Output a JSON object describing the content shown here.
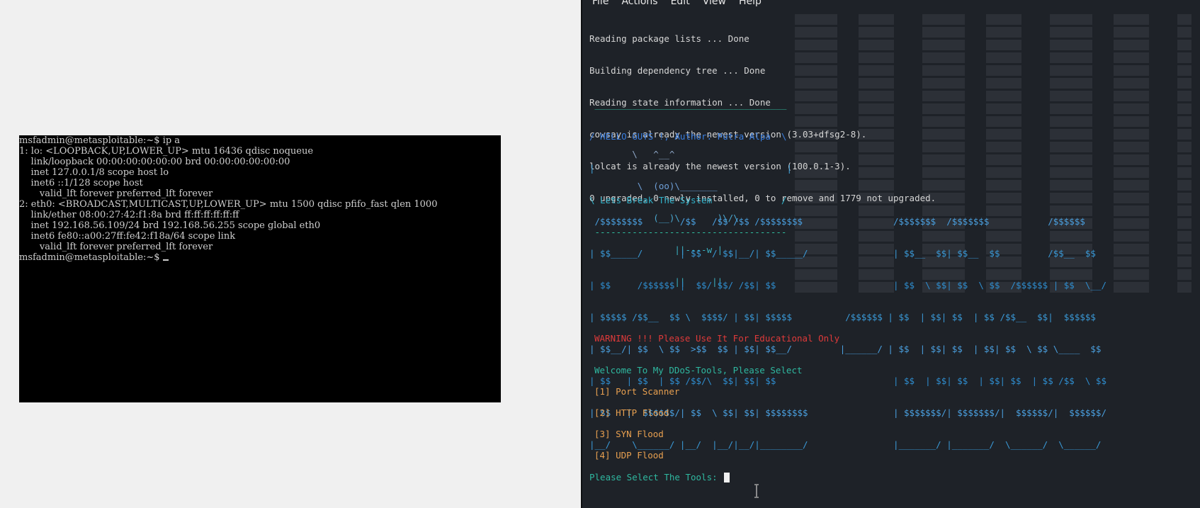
{
  "vm_console": {
    "lines": [
      "msfadmin@metasploitable:~$ ip a",
      "1: lo: <LOOPBACK,UP,LOWER_UP> mtu 16436 qdisc noqueue",
      "    link/loopback 00:00:00:00:00:00 brd 00:00:00:00:00:00",
      "    inet 127.0.0.1/8 scope host lo",
      "    inet6 ::1/128 scope host",
      "       valid_lft forever preferred_lft forever",
      "2: eth0: <BROADCAST,MULTICAST,UP,LOWER_UP> mtu 1500 qdisc pfifo_fast qlen 1000",
      "    link/ether 08:00:27:42:f1:8a brd ff:ff:ff:ff:ff:ff",
      "    inet 192.168.56.109/24 brd 192.168.56.255 scope global eth0",
      "    inet6 fe80::a00:27ff:fe42:f18a/64 scope link",
      "       valid_lft forever preferred_lft forever",
      "msfadmin@metasploitable:~$ "
    ]
  },
  "terminal": {
    "menu": [
      "File",
      "Actions",
      "Edit",
      "View",
      "Help"
    ],
    "apt_output": [
      "Reading package lists ... Done",
      "Building dependency tree ... Done",
      "Reading state information ... Done",
      "cowsay is already the newest version (3.03+dfsg2-8).",
      "lolcat is already the newest version (100.0.1-3).",
      "0 upgraded, 0 newly installed, 0 to remove and 1779 not upgraded."
    ],
    "speech_box": [
      " ____________________________________",
      "/ HELLO GUYS !, Author: Putra Alpa  \\",
      "|                                    |",
      "\\ Lets Break The System             /",
      " ------------------------------------"
    ],
    "cow": [
      "        \\   ^__^",
      "         \\  (oo)\\_______",
      "            (__)\\       )\\/\\",
      "                ||----w |",
      "                ||     ||"
    ],
    "banner": [
      " /$$$$$$$$       /$$   /$$ /$$ /$$$$$$$$                 /$$$$$$$  /$$$$$$$           /$$$$$$",
      "| $$_____/       | $$  / $$|__/| $$_____/                | $$__  $$| $$__  $$         /$$__  $$",
      "| $$     /$$$$$$ |  $$/ $$/ /$$| $$                      | $$  \\ $$| $$  \\ $$  /$$$$$$ | $$  \\__/",
      "| $$$$$ /$$__  $$ \\  $$$$/ | $$| $$$$$          /$$$$$$ | $$  | $$| $$  | $$ /$$__  $$|  $$$$$$",
      "| $$__/| $$  \\ $$  >$$  $$ | $$| $$__/         |______/ | $$  | $$| $$  | $$| $$  \\ $$ \\____  $$",
      "| $$   | $$  | $$ /$$/\\  $$| $$| $$                      | $$  | $$| $$  | $$| $$  | $$ /$$  \\ $$",
      "| $$   |  $$$$$$/| $$  \\ $$| $$| $$$$$$$$                | $$$$$$$/| $$$$$$$/|  $$$$$$/|  $$$$$$/",
      "|__/    \\______/ |__/  |__/|__/|________/                |_______/ |_______/  \\______/  \\______/"
    ],
    "warning": "WARNING !!! Please Use It For Educational Only",
    "welcome": "Welcome To My DDoS-Tools, Please Select",
    "options": [
      "[1] Port Scanner",
      "[2] HTTP Flood",
      "[3] SYN Flood",
      "[4] UDP Flood"
    ],
    "prompt": "Please Select The Tools: "
  },
  "colors": {
    "terminal_bg": "#1e2228",
    "warning": "#e03a3a",
    "welcome": "#2fb8a0",
    "option": "#e8a050",
    "banner": "#3a9ad8"
  }
}
